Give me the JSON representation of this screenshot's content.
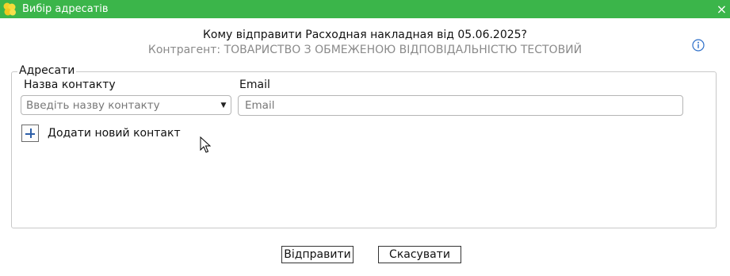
{
  "window": {
    "title": "Вибір адресатів",
    "close_glyph": "×"
  },
  "header": {
    "question": "Кому відправити Расходная накладная  від 05.06.2025?",
    "counterparty": "Контрагент: ТОВАРИСТВО З ОБМЕЖЕНОЮ ВІДПОВІДАЛЬНІСТЮ ТЕСТОВИЙ"
  },
  "recipients": {
    "legend": "Адресати",
    "contact_name_label": "Назва контакту",
    "contact_name_placeholder": "Введіть назву контакту",
    "email_label": "Email",
    "email_placeholder": "Email",
    "add_contact_label": "Додати новий контакт"
  },
  "buttons": {
    "send": "Відправити",
    "cancel": "Скасувати"
  },
  "icons": {
    "app": "flower-logo-icon",
    "info": "info-icon",
    "add": "plus-icon",
    "dropdown": "chevron-down-icon"
  },
  "colors": {
    "titlebar": "#3bb54a",
    "info_accent": "#2d6fc9",
    "hint_text": "#8a8a8a"
  }
}
